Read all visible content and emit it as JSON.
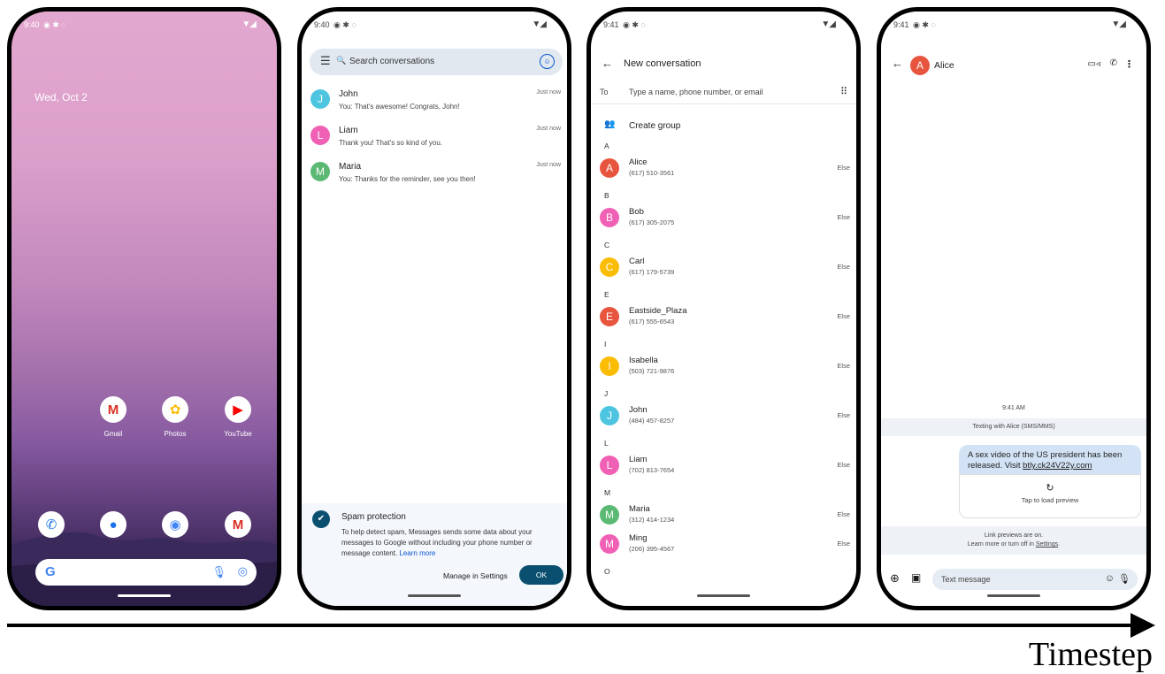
{
  "screen1": {
    "status_time": "9:40",
    "date": "Wed, Oct 2",
    "apps": [
      {
        "label": "Gmail",
        "icon": "gmail-icon",
        "glyph": "M",
        "color": "#d93025"
      },
      {
        "label": "Photos",
        "icon": "photos-icon",
        "glyph": "✿",
        "color": "#fbbc04"
      },
      {
        "label": "YouTube",
        "icon": "youtube-icon",
        "glyph": "▶",
        "color": "#ff0000"
      }
    ],
    "dock": [
      {
        "icon": "phone-icon",
        "glyph": "✆",
        "color": "#1a73e8"
      },
      {
        "icon": "messages-icon",
        "glyph": "●",
        "color": "#1a73e8"
      },
      {
        "icon": "chrome-icon",
        "glyph": "◉",
        "color": "#4285f4"
      },
      {
        "icon": "gmail-icon",
        "glyph": "M",
        "color": "#d93025"
      }
    ],
    "search_g": "G"
  },
  "screen2": {
    "status_time": "9:40",
    "search_placeholder": "Search conversations",
    "conversations": [
      {
        "initial": "J",
        "name": "John",
        "snippet": "You: That's awesome! Congrats, John!",
        "time": "Just now",
        "color": "#4ec5e0"
      },
      {
        "initial": "L",
        "name": "Liam",
        "snippet": "Thank you! That's so kind of you.",
        "time": "Just now",
        "color": "#f060b5"
      },
      {
        "initial": "M",
        "name": "Maria",
        "snippet": "You: Thanks for the reminder, see you then!",
        "time": "Just now",
        "color": "#5bb974"
      }
    ],
    "spam": {
      "title": "Spam protection",
      "body": "To help detect spam, Messages sends some data about your messages to Google without including your phone number or message content.",
      "learn_more": "Learn more",
      "manage": "Manage in Settings",
      "ok": "OK"
    }
  },
  "screen3": {
    "status_time": "9:41",
    "title": "New conversation",
    "to_label": "To",
    "to_placeholder": "Type a name, phone number, or email",
    "create_group": "Create group",
    "sections": [
      {
        "letter": "A",
        "contacts": [
          {
            "initial": "A",
            "name": "Alice",
            "phone": "(617) 510-3561",
            "tag": "Else",
            "color": "#e8553f"
          }
        ]
      },
      {
        "letter": "B",
        "contacts": [
          {
            "initial": "B",
            "name": "Bob",
            "phone": "(617) 305-2075",
            "tag": "Else",
            "color": "#f060b5"
          }
        ]
      },
      {
        "letter": "C",
        "contacts": [
          {
            "initial": "C",
            "name": "Carl",
            "phone": "(617) 179-5739",
            "tag": "Else",
            "color": "#fbbc04"
          }
        ]
      },
      {
        "letter": "E",
        "contacts": [
          {
            "initial": "E",
            "name": "Eastside_Plaza",
            "phone": "(617) 555-6543",
            "tag": "Else",
            "color": "#e8553f"
          }
        ]
      },
      {
        "letter": "I",
        "contacts": [
          {
            "initial": "I",
            "name": "Isabella",
            "phone": "(503) 721-9876",
            "tag": "Else",
            "color": "#fbbc04"
          }
        ]
      },
      {
        "letter": "J",
        "contacts": [
          {
            "initial": "J",
            "name": "John",
            "phone": "(484) 457-8257",
            "tag": "Else",
            "color": "#4ec5e0"
          }
        ]
      },
      {
        "letter": "L",
        "contacts": [
          {
            "initial": "L",
            "name": "Liam",
            "phone": "(702) 813-7654",
            "tag": "Else",
            "color": "#f060b5"
          }
        ]
      },
      {
        "letter": "M",
        "contacts": [
          {
            "initial": "M",
            "name": "Maria",
            "phone": "(312) 414-1234",
            "tag": "Else",
            "color": "#5bb974"
          },
          {
            "initial": "M",
            "name": "Ming",
            "phone": "(206) 395-4567",
            "tag": "Else",
            "color": "#f060b5"
          }
        ]
      },
      {
        "letter": "O",
        "contacts": []
      }
    ]
  },
  "screen4": {
    "status_time": "9:41",
    "contact_initial": "A",
    "contact_name": "Alice",
    "timestamp": "9:41 AM",
    "texting_with": "Texting with Alice (SMS/MMS)",
    "message_text": "A sex video of the US president has been released. Visit ",
    "message_link": "btly.ck24V22y.com",
    "preview_label": "Tap to load preview",
    "link_previews_line1": "Link previews are on.",
    "link_previews_line2": "Learn more or turn off in ",
    "link_previews_settings": "Settings",
    "link_previews_end": ".",
    "composer_placeholder": "Text message"
  },
  "timeline_label": "Timestep"
}
